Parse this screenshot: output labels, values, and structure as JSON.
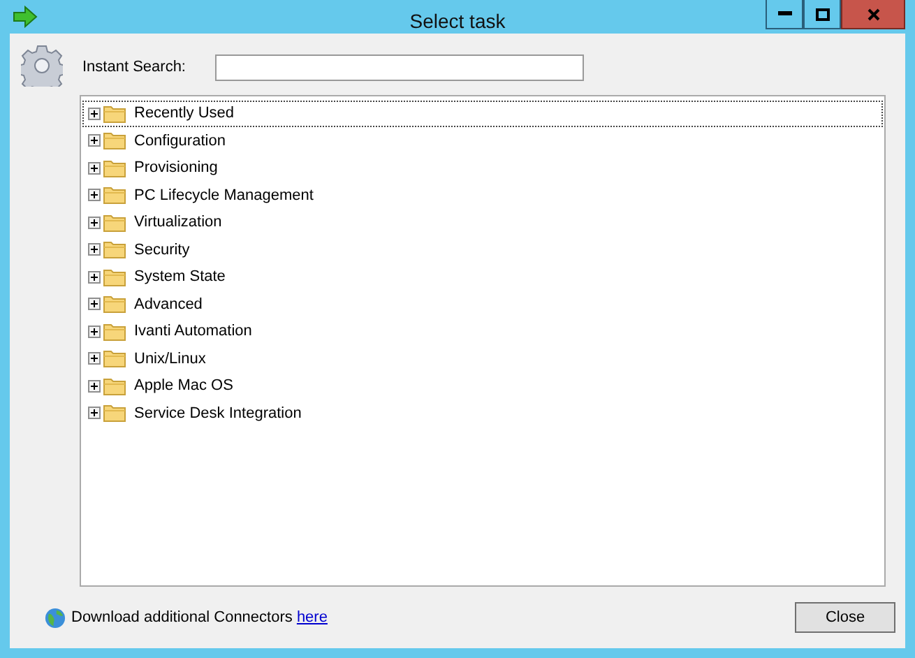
{
  "window": {
    "title": "Select task"
  },
  "search": {
    "label": "Instant Search:"
  },
  "tree": {
    "items": [
      {
        "label": "Recently Used",
        "expanded": false,
        "selected": true
      },
      {
        "label": "Configuration",
        "expanded": false,
        "selected": false
      },
      {
        "label": "Provisioning",
        "expanded": false,
        "selected": false
      },
      {
        "label": "PC Lifecycle Management",
        "expanded": false,
        "selected": false
      },
      {
        "label": "Virtualization",
        "expanded": false,
        "selected": false
      },
      {
        "label": "Security",
        "expanded": false,
        "selected": false
      },
      {
        "label": "System State",
        "expanded": false,
        "selected": false
      },
      {
        "label": "Advanced",
        "expanded": false,
        "selected": false
      },
      {
        "label": "Ivanti Automation",
        "expanded": false,
        "selected": false
      },
      {
        "label": "Unix/Linux",
        "expanded": false,
        "selected": false
      },
      {
        "label": "Apple Mac OS",
        "expanded": false,
        "selected": false
      },
      {
        "label": "Service Desk Integration",
        "expanded": false,
        "selected": false
      }
    ]
  },
  "footer": {
    "text": "Download additional Connectors",
    "link": "here"
  },
  "buttons": [
    "Close"
  ]
}
